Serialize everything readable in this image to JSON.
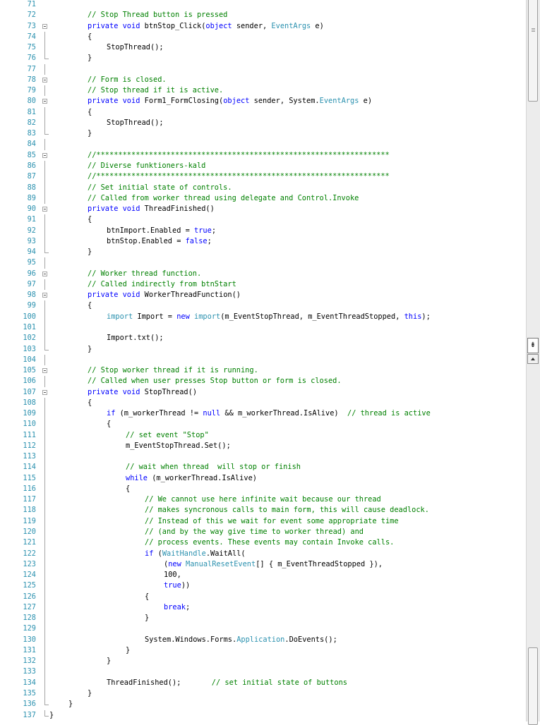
{
  "lines": [
    {
      "n": "71",
      "indent": 0,
      "tokens": []
    },
    {
      "n": "72",
      "indent": 2,
      "tokens": [
        [
          "cm",
          "// Stop Thread button is pressed"
        ]
      ]
    },
    {
      "n": "73",
      "indent": 2,
      "tokens": [
        [
          "kw",
          "private"
        ],
        [
          "tx",
          " "
        ],
        [
          "kw",
          "void"
        ],
        [
          "tx",
          " btnStop_Click("
        ],
        [
          "kw",
          "object"
        ],
        [
          "tx",
          " sender, "
        ],
        [
          "ty",
          "EventArgs"
        ],
        [
          "tx",
          " e)"
        ]
      ]
    },
    {
      "n": "74",
      "indent": 2,
      "tokens": [
        [
          "tx",
          "{"
        ]
      ]
    },
    {
      "n": "75",
      "indent": 3,
      "tokens": [
        [
          "tx",
          "StopThread();"
        ]
      ]
    },
    {
      "n": "76",
      "indent": 2,
      "tokens": [
        [
          "tx",
          "}"
        ]
      ]
    },
    {
      "n": "77",
      "indent": 0,
      "tokens": []
    },
    {
      "n": "78",
      "indent": 2,
      "tokens": [
        [
          "cm",
          "// Form is closed."
        ]
      ]
    },
    {
      "n": "79",
      "indent": 2,
      "tokens": [
        [
          "cm",
          "// Stop thread if it is active."
        ]
      ]
    },
    {
      "n": "80",
      "indent": 2,
      "tokens": [
        [
          "kw",
          "private"
        ],
        [
          "tx",
          " "
        ],
        [
          "kw",
          "void"
        ],
        [
          "tx",
          " Form1_FormClosing("
        ],
        [
          "kw",
          "object"
        ],
        [
          "tx",
          " sender, System."
        ],
        [
          "ty",
          "EventArgs"
        ],
        [
          "tx",
          " e)"
        ]
      ]
    },
    {
      "n": "81",
      "indent": 2,
      "tokens": [
        [
          "tx",
          "{"
        ]
      ]
    },
    {
      "n": "82",
      "indent": 3,
      "tokens": [
        [
          "tx",
          "StopThread();"
        ]
      ]
    },
    {
      "n": "83",
      "indent": 2,
      "tokens": [
        [
          "tx",
          "}"
        ]
      ]
    },
    {
      "n": "84",
      "indent": 0,
      "tokens": []
    },
    {
      "n": "85",
      "indent": 2,
      "tokens": [
        [
          "cm",
          "//*******************************************************************"
        ]
      ]
    },
    {
      "n": "86",
      "indent": 2,
      "tokens": [
        [
          "cm",
          "// Diverse funktioners-kald"
        ]
      ]
    },
    {
      "n": "87",
      "indent": 2,
      "tokens": [
        [
          "cm",
          "//*******************************************************************"
        ]
      ]
    },
    {
      "n": "88",
      "indent": 2,
      "tokens": [
        [
          "cm",
          "// Set initial state of controls."
        ]
      ]
    },
    {
      "n": "89",
      "indent": 2,
      "tokens": [
        [
          "cm",
          "// Called from worker thread using delegate and Control.Invoke"
        ]
      ]
    },
    {
      "n": "90",
      "indent": 2,
      "tokens": [
        [
          "kw",
          "private"
        ],
        [
          "tx",
          " "
        ],
        [
          "kw",
          "void"
        ],
        [
          "tx",
          " ThreadFinished()"
        ]
      ]
    },
    {
      "n": "91",
      "indent": 2,
      "tokens": [
        [
          "tx",
          "{"
        ]
      ]
    },
    {
      "n": "92",
      "indent": 3,
      "tokens": [
        [
          "tx",
          "btnImport.Enabled = "
        ],
        [
          "kw",
          "true"
        ],
        [
          "tx",
          ";"
        ]
      ]
    },
    {
      "n": "93",
      "indent": 3,
      "tokens": [
        [
          "tx",
          "btnStop.Enabled = "
        ],
        [
          "kw",
          "false"
        ],
        [
          "tx",
          ";"
        ]
      ]
    },
    {
      "n": "94",
      "indent": 2,
      "tokens": [
        [
          "tx",
          "}"
        ]
      ]
    },
    {
      "n": "95",
      "indent": 0,
      "tokens": []
    },
    {
      "n": "96",
      "indent": 2,
      "tokens": [
        [
          "cm",
          "// Worker thread function."
        ]
      ]
    },
    {
      "n": "97",
      "indent": 2,
      "tokens": [
        [
          "cm",
          "// Called indirectly from btnStart"
        ]
      ]
    },
    {
      "n": "98",
      "indent": 2,
      "tokens": [
        [
          "kw",
          "private"
        ],
        [
          "tx",
          " "
        ],
        [
          "kw",
          "void"
        ],
        [
          "tx",
          " WorkerThreadFunction()"
        ]
      ]
    },
    {
      "n": "99",
      "indent": 2,
      "tokens": [
        [
          "tx",
          "{"
        ]
      ]
    },
    {
      "n": "100",
      "indent": 3,
      "tokens": [
        [
          "ty",
          "import"
        ],
        [
          "tx",
          " Import = "
        ],
        [
          "kw",
          "new"
        ],
        [
          "tx",
          " "
        ],
        [
          "ty",
          "import"
        ],
        [
          "tx",
          "(m_EventStopThread, m_EventThreadStopped, "
        ],
        [
          "kw",
          "this"
        ],
        [
          "tx",
          ");"
        ]
      ]
    },
    {
      "n": "101",
      "indent": 0,
      "tokens": []
    },
    {
      "n": "102",
      "indent": 3,
      "tokens": [
        [
          "tx",
          "Import.txt();"
        ]
      ]
    },
    {
      "n": "103",
      "indent": 2,
      "tokens": [
        [
          "tx",
          "}"
        ]
      ]
    },
    {
      "n": "104",
      "indent": 0,
      "tokens": []
    },
    {
      "n": "105",
      "indent": 2,
      "tokens": [
        [
          "cm",
          "// Stop worker thread if it is running."
        ]
      ]
    },
    {
      "n": "106",
      "indent": 2,
      "tokens": [
        [
          "cm",
          "// Called when user presses Stop button or form is closed."
        ]
      ]
    },
    {
      "n": "107",
      "indent": 2,
      "tokens": [
        [
          "kw",
          "private"
        ],
        [
          "tx",
          " "
        ],
        [
          "kw",
          "void"
        ],
        [
          "tx",
          " StopThread()"
        ]
      ]
    },
    {
      "n": "108",
      "indent": 2,
      "tokens": [
        [
          "tx",
          "{"
        ]
      ]
    },
    {
      "n": "109",
      "indent": 3,
      "tokens": [
        [
          "kw",
          "if"
        ],
        [
          "tx",
          " (m_workerThread != "
        ],
        [
          "kw",
          "null"
        ],
        [
          "tx",
          " && m_workerThread.IsAlive)  "
        ],
        [
          "cm",
          "// thread is active"
        ]
      ]
    },
    {
      "n": "110",
      "indent": 3,
      "tokens": [
        [
          "tx",
          "{"
        ]
      ]
    },
    {
      "n": "111",
      "indent": 4,
      "tokens": [
        [
          "cm",
          "// set event \"Stop\""
        ]
      ]
    },
    {
      "n": "112",
      "indent": 4,
      "tokens": [
        [
          "tx",
          "m_EventStopThread.Set();"
        ]
      ]
    },
    {
      "n": "113",
      "indent": 0,
      "tokens": []
    },
    {
      "n": "114",
      "indent": 4,
      "tokens": [
        [
          "cm",
          "// wait when thread  will stop or finish"
        ]
      ]
    },
    {
      "n": "115",
      "indent": 4,
      "tokens": [
        [
          "kw",
          "while"
        ],
        [
          "tx",
          " (m_workerThread.IsAlive)"
        ]
      ]
    },
    {
      "n": "116",
      "indent": 4,
      "tokens": [
        [
          "tx",
          "{"
        ]
      ]
    },
    {
      "n": "117",
      "indent": 5,
      "tokens": [
        [
          "cm",
          "// We cannot use here infinite wait because our thread"
        ]
      ]
    },
    {
      "n": "118",
      "indent": 5,
      "tokens": [
        [
          "cm",
          "// makes syncronous calls to main form, this will cause deadlock."
        ]
      ]
    },
    {
      "n": "119",
      "indent": 5,
      "tokens": [
        [
          "cm",
          "// Instead of this we wait for event some appropriate time"
        ]
      ]
    },
    {
      "n": "120",
      "indent": 5,
      "tokens": [
        [
          "cm",
          "// (and by the way give time to worker thread) and"
        ]
      ]
    },
    {
      "n": "121",
      "indent": 5,
      "tokens": [
        [
          "cm",
          "// process events. These events may contain Invoke calls."
        ]
      ]
    },
    {
      "n": "122",
      "indent": 5,
      "tokens": [
        [
          "kw",
          "if"
        ],
        [
          "tx",
          " ("
        ],
        [
          "ty",
          "WaitHandle"
        ],
        [
          "tx",
          ".WaitAll("
        ]
      ]
    },
    {
      "n": "123",
      "indent": 6,
      "tokens": [
        [
          "tx",
          "("
        ],
        [
          "kw",
          "new"
        ],
        [
          "tx",
          " "
        ],
        [
          "ty",
          "ManualResetEvent"
        ],
        [
          "tx",
          "[] { m_EventThreadStopped }),"
        ]
      ]
    },
    {
      "n": "124",
      "indent": 6,
      "tokens": [
        [
          "tx",
          "100,"
        ]
      ]
    },
    {
      "n": "125",
      "indent": 6,
      "tokens": [
        [
          "kw",
          "true"
        ],
        [
          "tx",
          "))"
        ]
      ]
    },
    {
      "n": "126",
      "indent": 5,
      "tokens": [
        [
          "tx",
          "{"
        ]
      ]
    },
    {
      "n": "127",
      "indent": 6,
      "tokens": [
        [
          "kw",
          "break"
        ],
        [
          "tx",
          ";"
        ]
      ]
    },
    {
      "n": "128",
      "indent": 5,
      "tokens": [
        [
          "tx",
          "}"
        ]
      ]
    },
    {
      "n": "129",
      "indent": 0,
      "tokens": []
    },
    {
      "n": "130",
      "indent": 5,
      "tokens": [
        [
          "tx",
          "System.Windows.Forms."
        ],
        [
          "ty",
          "Application"
        ],
        [
          "tx",
          ".DoEvents();"
        ]
      ]
    },
    {
      "n": "131",
      "indent": 4,
      "tokens": [
        [
          "tx",
          "}"
        ]
      ]
    },
    {
      "n": "132",
      "indent": 3,
      "tokens": [
        [
          "tx",
          "}"
        ]
      ]
    },
    {
      "n": "133",
      "indent": 0,
      "tokens": []
    },
    {
      "n": "134",
      "indent": 3,
      "tokens": [
        [
          "tx",
          "ThreadFinished();       "
        ],
        [
          "cm",
          "// set initial state of buttons"
        ]
      ]
    },
    {
      "n": "135",
      "indent": 2,
      "tokens": [
        [
          "tx",
          "}"
        ]
      ]
    },
    {
      "n": "136",
      "indent": 1,
      "tokens": [
        [
          "tx",
          "}"
        ]
      ]
    },
    {
      "n": "137",
      "indent": 0,
      "tokens": [
        [
          "tx",
          "}"
        ]
      ]
    }
  ],
  "colors": {
    "keyword": "#0000ff",
    "comment": "#008000",
    "type": "#2b91af",
    "text": "#000000",
    "line_number": "#2b91af"
  },
  "scrollbar": {
    "split_button_glyph": "⇟"
  }
}
